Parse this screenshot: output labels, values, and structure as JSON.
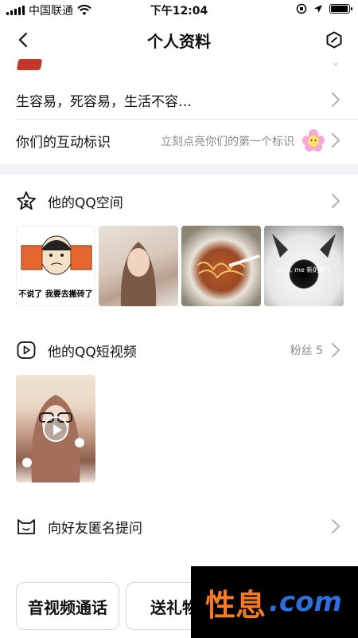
{
  "status_bar": {
    "carrier": "中国联通",
    "time": "下午12:04",
    "battery_level": 0.95
  },
  "nav": {
    "title": "个人资料"
  },
  "signature_row": {
    "text": "生容易，死容易，生活不容…"
  },
  "interaction_mark_row": {
    "label": "你们的互动标识",
    "hint": "立刻点亮你们的第一个标识"
  },
  "qzone": {
    "label": "他的QQ空间",
    "photos": [
      {
        "caption": "不说了 我要去搬砖了"
      },
      {
        "caption": ""
      },
      {
        "caption": ""
      },
      {
        "caption": "o个人 me 新的笑了"
      }
    ]
  },
  "short_video": {
    "label": "他的QQ短视频",
    "fans": "粉丝 5"
  },
  "anonymous_question": {
    "label": "向好友匿名提问"
  },
  "bottom_actions": {
    "call_label": "音视频通话",
    "gift_label": "送礼物"
  },
  "watermark": {
    "part_a": "性息",
    "part_b": ".com"
  },
  "colors": {
    "chevron": "#b0b0b0",
    "muted_text": "#8a8a8a",
    "section_gap": "#f2f2f7"
  }
}
